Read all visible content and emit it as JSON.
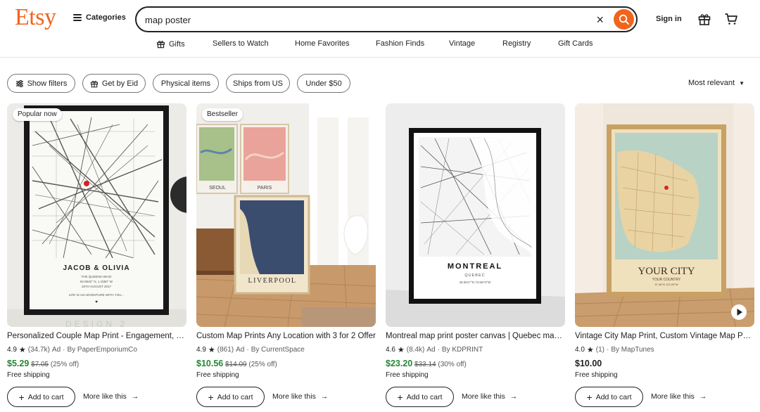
{
  "header": {
    "logo": "Etsy",
    "categories": "Categories",
    "search": {
      "value": "map poster",
      "clear": "×"
    },
    "signin": "Sign in",
    "nav": [
      {
        "label": "Gifts",
        "icon": "gift-icon"
      },
      {
        "label": "Sellers to Watch"
      },
      {
        "label": "Home Favorites"
      },
      {
        "label": "Fashion Finds"
      },
      {
        "label": "Vintage"
      },
      {
        "label": "Registry"
      },
      {
        "label": "Gift Cards"
      }
    ]
  },
  "filters": {
    "chips": [
      "Show filters",
      "Get by Eid",
      "Physical items",
      "Ships from US",
      "Under $50"
    ],
    "sort": "Most relevant"
  },
  "listings": [
    {
      "badge": "Popular now",
      "title": "Personalized Couple Map Print - Engagement, Wedding, Anniversary Gift",
      "rating": "4.9",
      "reviews": "(34.7k)",
      "ad": "Ad",
      "seller": "By PaperEmporiumCo",
      "price": "$5.29",
      "orig_price": "$7.05",
      "discount": "(25% off)",
      "shipping": "Free shipping",
      "add_to_cart": "Add to cart",
      "more_like": "More like this",
      "poster_title": "JACOB & OLIVIA",
      "poster_sub1": "THE QUEENS HEAD",
      "poster_sub2": "52.9540° N, 1.1550° W",
      "poster_sub3": "25TH AUGUST 2017",
      "poster_quote": "LIFE IS AN ADVENTURE WITH YOU...",
      "poster_footer": "DESIGN 2"
    },
    {
      "badge": "Bestseller",
      "title": "Custom Map Prints Any Location with 3 for 2 Offer",
      "rating": "4.9",
      "reviews": "(861)",
      "ad": "Ad",
      "seller": "By CurrentSpace",
      "price": "$10.56",
      "orig_price": "$14.09",
      "discount": "(25% off)",
      "shipping": "Free shipping",
      "add_to_cart": "Add to cart",
      "more_like": "More like this",
      "poster_a": "SEOUL",
      "poster_b": "PARIS",
      "poster_c": "LIVERPOOL"
    },
    {
      "badge": "",
      "title": "Montreal map print poster canvas | Quebec map print poster canvas",
      "rating": "4.6",
      "reviews": "(8.4k)",
      "ad": "Ad",
      "seller": "By KDPRINT",
      "price": "$23.20",
      "orig_price": "$33.14",
      "discount": "(30% off)",
      "shipping": "Free shipping",
      "add_to_cart": "Add to cart",
      "more_like": "More like this",
      "poster_title": "MONTREAL",
      "poster_sub1": "QUEBEC",
      "poster_sub2": "45.5017°N 73.5673°W"
    },
    {
      "badge": "",
      "title": "Vintage City Map Print, Custom Vintage Map Poster",
      "rating": "4.0",
      "reviews": "(1)",
      "ad": "",
      "seller": "By MapTunes",
      "price": "$10.00",
      "orig_price": "",
      "discount": "",
      "shipping": "Free shipping",
      "add_to_cart": "Add to cart",
      "more_like": "More like this",
      "poster_title": "YOUR CITY",
      "poster_sub1": "YOUR COUNTRY",
      "poster_sub2": "37.46°N 122.25°W"
    }
  ],
  "colors": {
    "brand": "#f1641e",
    "sale_price": "#258635",
    "text": "#222222",
    "border": "#757575"
  }
}
